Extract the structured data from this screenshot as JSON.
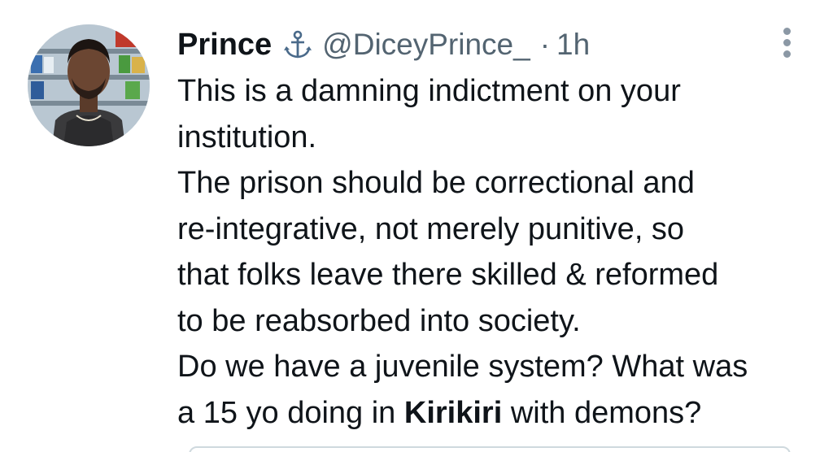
{
  "author": {
    "name": "Prince",
    "badge_icon": "anchor-icon",
    "handle": "@DiceyPrince_",
    "separator": "·",
    "time": "1h"
  },
  "menu": {
    "icon": "more-vertical-icon"
  },
  "tweet": {
    "lines": [
      {
        "text": "This is a damning indictment on your"
      },
      {
        "text": "institution."
      },
      {
        "text": "The prison should be correctional and"
      },
      {
        "text": "re-integrative, not merely punitive, so"
      },
      {
        "text": "that folks leave there skilled & reformed"
      },
      {
        "text": "to be reabsorbed into society."
      },
      {
        "text": "Do we have a juvenile system? What was"
      },
      {
        "text_before": "a 15 yo doing in ",
        "bold": "Kirikiri",
        "text_after": " with demons?"
      }
    ]
  },
  "colors": {
    "text": "#0f1419",
    "secondary": "#536471",
    "badge": "#4a6a8a"
  }
}
